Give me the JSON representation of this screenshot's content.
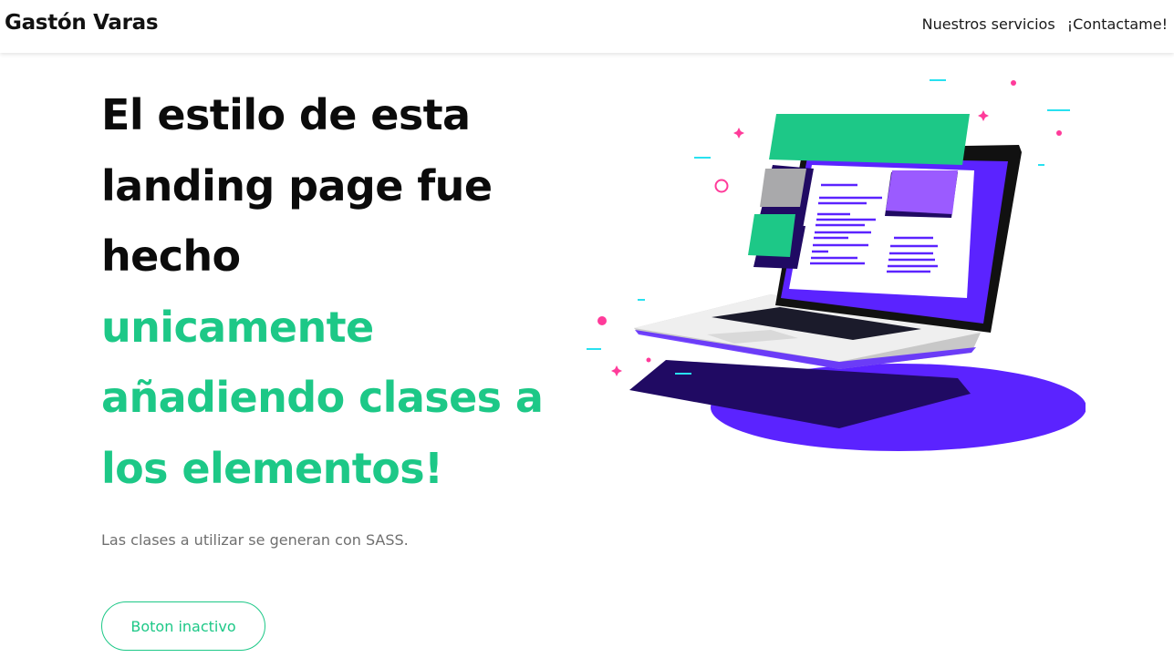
{
  "header": {
    "brand": "Gastón Varas",
    "nav": [
      {
        "label": "Nuestros servicios"
      },
      {
        "label": "¡Contactame!"
      }
    ]
  },
  "hero": {
    "title_lines": [
      "El estilo de esta",
      "landing page fue",
      "hecho"
    ],
    "accent_lines": [
      "unicamente",
      "añadiendo clases a",
      "los elementos!"
    ],
    "subtitle": "Las clases a utilizar se generan con SASS.",
    "button_label": "Boton inactivo"
  },
  "illustration": {
    "icon": "laptop-illustration"
  },
  "colors": {
    "accent": "#1dc887",
    "text_dark": "#0b0b0b",
    "text_muted": "#6f6f6f",
    "purple": "#5b23ff",
    "dark_purple": "#200a63",
    "pink": "#ff3b9a",
    "cyan": "#28e1f0"
  }
}
